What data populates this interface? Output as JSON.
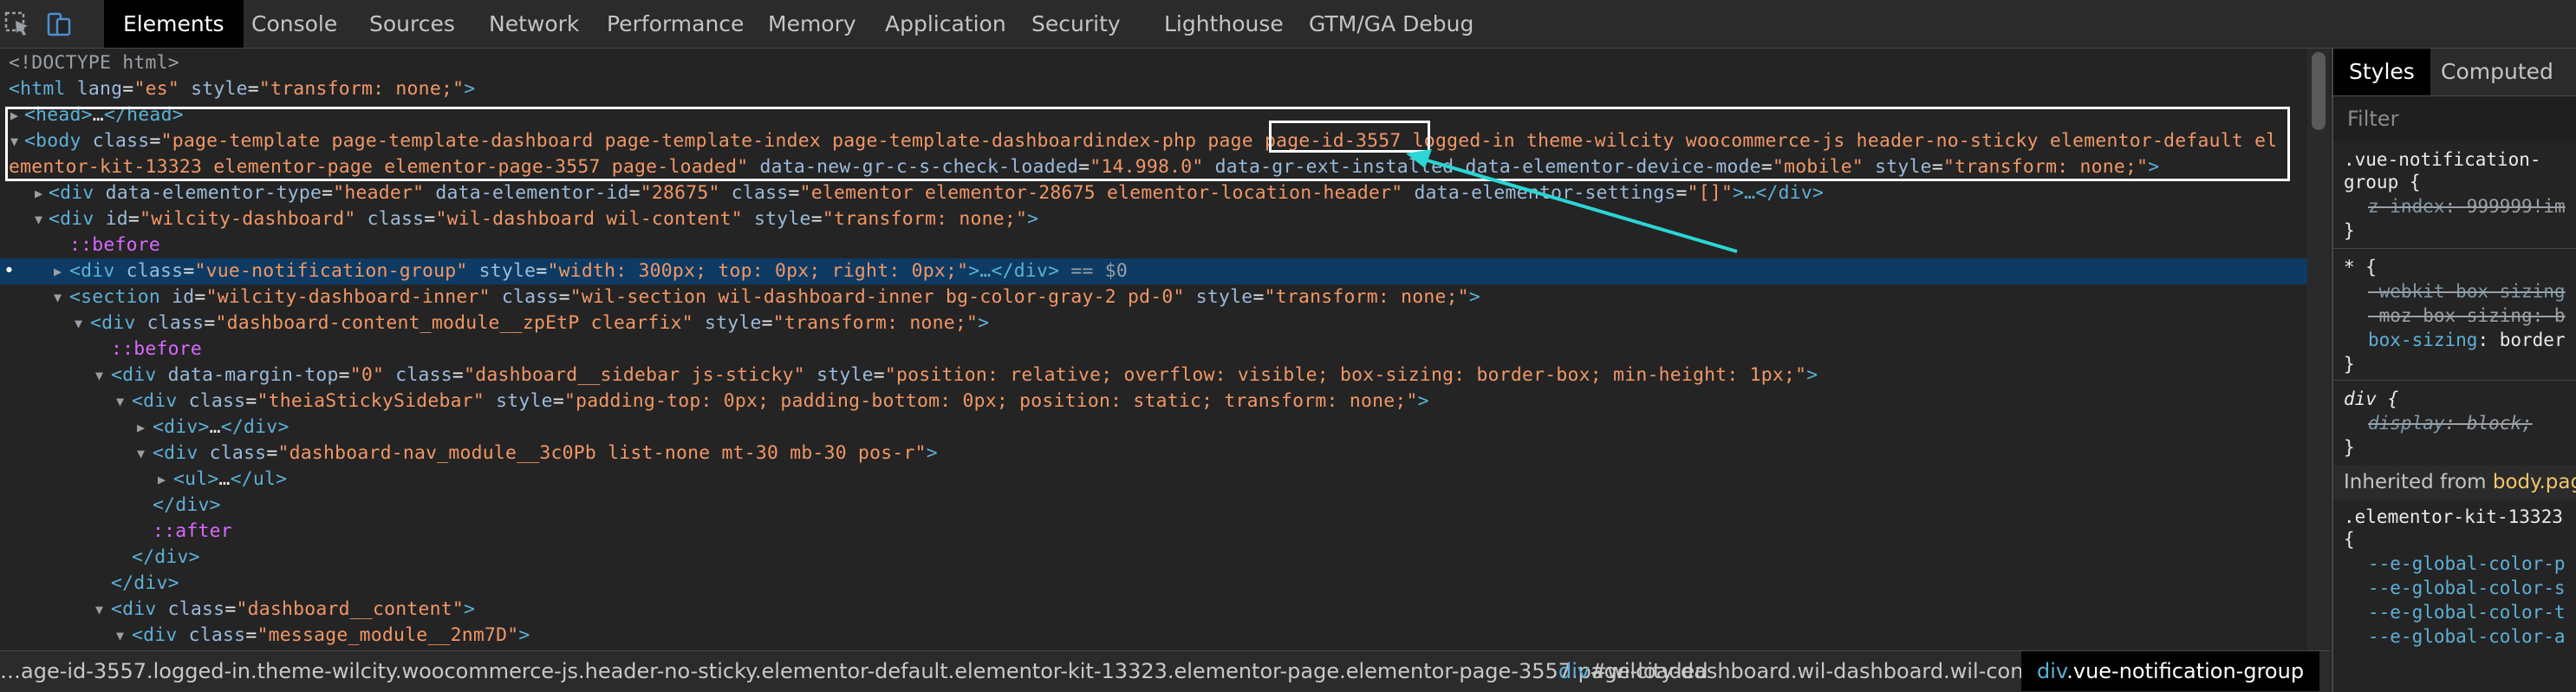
{
  "toolbar": {
    "tabs": [
      "Elements",
      "Console",
      "Sources",
      "Network",
      "Performance",
      "Memory",
      "Application",
      "Security",
      "Lighthouse",
      "GTM/GA Debug"
    ],
    "active_tab": "Elements",
    "icons": [
      "inspect-element-icon",
      "device-toolbar-icon"
    ]
  },
  "tree": {
    "l1": "<!DOCTYPE html>",
    "l2_tag_open": "<html ",
    "l2_a1": "lang",
    "l2_v1": "\"es\"",
    "l2_a2": "style",
    "l2_v2": "\"transform: none;\"",
    "l2_close": ">",
    "l3": "<head>",
    "l3_ell": "…",
    "l3_close": "</head>",
    "l4_tag": "<body ",
    "l4_a1": "class",
    "l4_v1": "\"page-template page-template-dashboard page-template-index page-template-dashboardindex-php page page-id-3557 logged-in theme-wilcity woocommerce-js header-no-sticky elementor-default el",
    "l5_v1": "ementor-kit-13323 elementor-page elementor-page-3557 page-loaded\"",
    "l5_a2": "data-new-gr-c-s-check-loaded",
    "l5_v2": "\"14.998.0\"",
    "l5_a3": "data-gr-ext-installed",
    "l5_a4": "data-elementor-device-mode",
    "l5_v4": "\"mobile\"",
    "l5_a5": "style",
    "l5_v5": "\"transform: none;\"",
    "l6_tag": "<div ",
    "l6_a1": "data-elementor-type",
    "l6_v1": "\"header\"",
    "l6_a2": "data-elementor-id",
    "l6_v2": "\"28675\"",
    "l6_a3": "class",
    "l6_v3": "\"elementor elementor-28675 elementor-location-header\"",
    "l6_a4": "data-elementor-settings",
    "l6_v4": "\"[]\"",
    "l6_end": ">…</div>",
    "l7_tag": "<div ",
    "l7_a1": "id",
    "l7_v1": "\"wilcity-dashboard\"",
    "l7_a2": "class",
    "l7_v2": "\"wil-dashboard wil-content\"",
    "l7_a3": "style",
    "l7_v3": "\"transform: none;\"",
    "l8": "::before",
    "l9_tag": "<div ",
    "l9_a1": "class",
    "l9_v1": "\"vue-notification-group\"",
    "l9_a2": "style",
    "l9_v2": "\"width: 300px; top: 0px; right: 0px;\"",
    "l9_end": ">…</div>",
    "l9_eq": " == $0",
    "l10_tag": "<section ",
    "l10_a1": "id",
    "l10_v1": "\"wilcity-dashboard-inner\"",
    "l10_a2": "class",
    "l10_v2": "\"wil-section wil-dashboard-inner bg-color-gray-2 pd-0\"",
    "l10_a3": "style",
    "l10_v3": "\"transform: none;\"",
    "l11_tag": "<div ",
    "l11_a1": "class",
    "l11_v1": "\"dashboard-content_module__zpEtP clearfix\"",
    "l11_a2": "style",
    "l11_v2": "\"transform: none;\"",
    "l12": "::before",
    "l13_tag": "<div ",
    "l13_a1": "data-margin-top",
    "l13_v1": "\"0\"",
    "l13_a2": "class",
    "l13_v2": "\"dashboard__sidebar js-sticky\"",
    "l13_a3": "style",
    "l13_v3": "\"position: relative; overflow: visible; box-sizing: border-box; min-height: 1px;\"",
    "l14_tag": "<div ",
    "l14_a1": "class",
    "l14_v1": "\"theiaStickySidebar\"",
    "l14_a2": "style",
    "l14_v2": "\"padding-top: 0px; padding-bottom: 0px; position: static; transform: none;\"",
    "l15": "<div>",
    "l15_ell": "…",
    "l15_close": "</div>",
    "l16_tag": "<div ",
    "l16_a1": "class",
    "l16_v1": "\"dashboard-nav_module__3c0Pb list-none mt-30 mb-30 pos-r\"",
    "l17": "<ul>",
    "l17_ell": "…",
    "l17_close": "</ul>",
    "l18": "</div>",
    "l19": "::after",
    "l20": "</div>",
    "l21": "</div>",
    "l22_tag": "<div ",
    "l22_a1": "class",
    "l22_v1": "\"dashboard__content\"",
    "l23_tag": "<div ",
    "l23_a1": "class",
    "l23_v1": "\"message_module__2nm7D\""
  },
  "breadcrumbs": {
    "c1": "…age-id-3557.logged-in.theme-wilcity.woocommerce-js.header-no-sticky.elementor-default.elementor-kit-13323.elementor-page.elementor-page-3557.page-loaded",
    "c2_tag": "div",
    "c2_rest": "#wilcity-dashboard.wil-dashboard.wil-content",
    "c3_tag": "div",
    "c3_rest": ".vue-notification-group"
  },
  "styles": {
    "tabs": [
      "Styles",
      "Computed"
    ],
    "active_tab": "Styles",
    "filter_placeholder": "Filter",
    "r1_sel_a": ".vue-notification-",
    "r1_sel_b": "group {",
    "r1_prop": "z-index",
    "r1_val": ": 999999!im",
    "close": "}",
    "r2_sel": "* {",
    "r2_p1": "-webkit-box-sizing",
    "r2_p2": "-moz-box-sizing: b",
    "r2_p3": "box-sizing",
    "r2_v3": ": border",
    "r3_sel": "div {",
    "r3_p1": "display",
    "r3_v1": ": block;",
    "inherited_label": "Inherited from ",
    "inherited_link": "body.pag",
    "r4_sel": ".elementor-kit-13323",
    "r4_open": "{",
    "r4_p1": "--e-global-color-p",
    "r4_p2": "--e-global-color-s",
    "r4_p3": "--e-global-color-t",
    "r4_p4": "--e-global-color-a"
  },
  "colors": {
    "accent_arrow": "#2ad6d6",
    "selected_row": "#0e3b63",
    "tag": "#5db0d7",
    "attr_value": "#f29766"
  }
}
